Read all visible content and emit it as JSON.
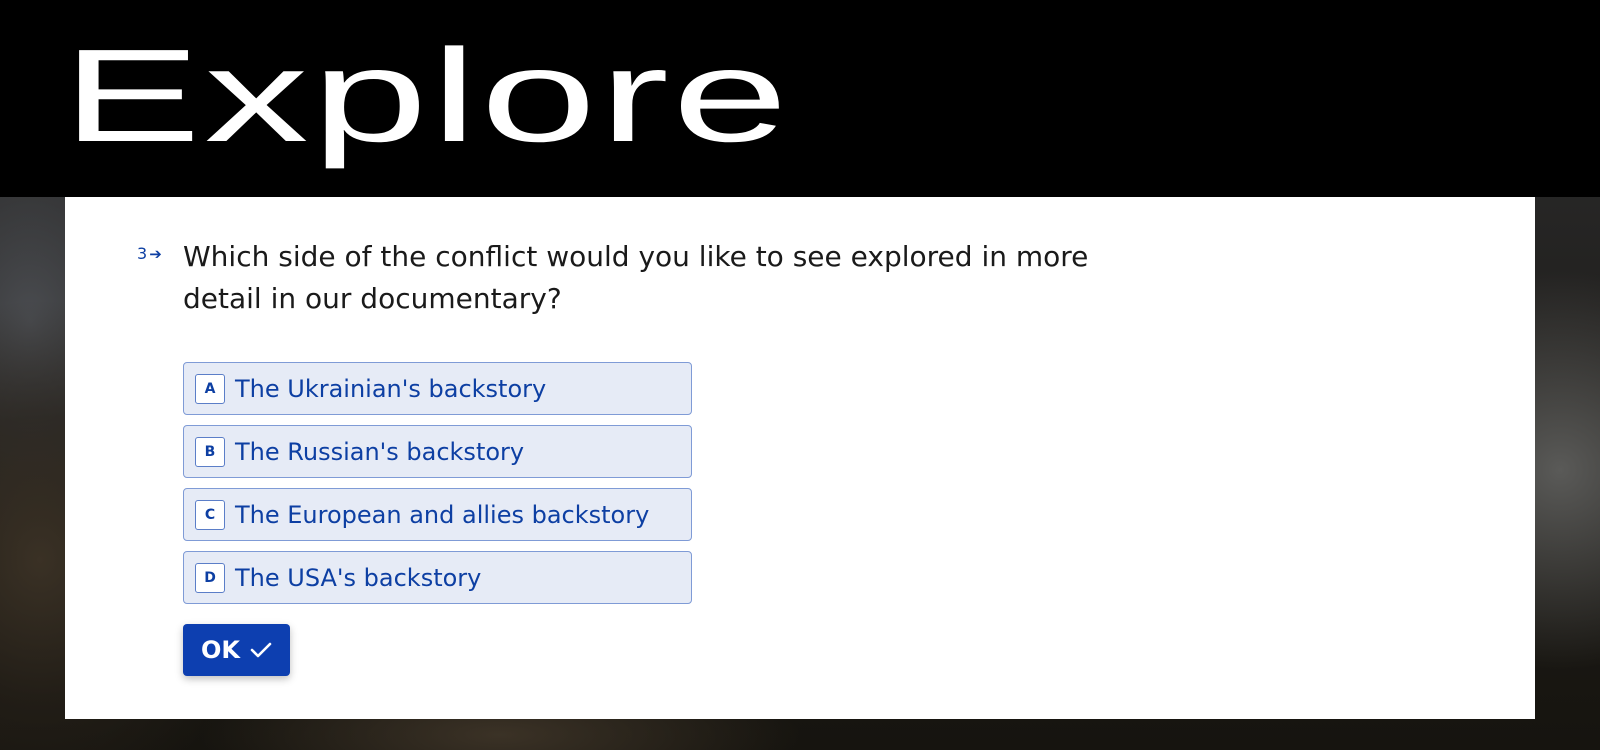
{
  "header": {
    "title": "Explore"
  },
  "question": {
    "number": "3",
    "text": "Which side of the conflict would you like to see explored in more detail in our documentary?",
    "options": [
      {
        "key": "A",
        "label": "The Ukrainian's backstory"
      },
      {
        "key": "B",
        "label": "The Russian's backstory"
      },
      {
        "key": "C",
        "label": "The European and allies backstory"
      },
      {
        "key": "D",
        "label": "The USA's backstory"
      }
    ]
  },
  "actions": {
    "ok_label": "OK",
    "ok_icon": "check-icon"
  },
  "colors": {
    "accent": "#0d3fb0",
    "option_bg": "#e6ebf6",
    "option_border": "#7f9bd6",
    "header_bg": "#000000"
  }
}
